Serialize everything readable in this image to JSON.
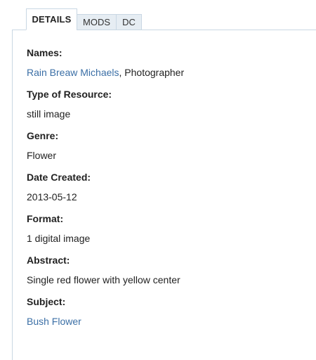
{
  "tabs": [
    {
      "label": "DETAILS",
      "active": true
    },
    {
      "label": "MODS",
      "active": false
    },
    {
      "label": "DC",
      "active": false
    }
  ],
  "fields": {
    "names": {
      "label": "Names:",
      "value_link": "Rain Breaw Michaels",
      "value_suffix": ", Photographer"
    },
    "type_of_resource": {
      "label": "Type of Resource:",
      "value": "still image"
    },
    "genre": {
      "label": "Genre:",
      "value": "Flower"
    },
    "date_created": {
      "label": "Date Created:",
      "value": "2013-05-12"
    },
    "format": {
      "label": "Format:",
      "value": "1 digital image"
    },
    "abstract": {
      "label": "Abstract:",
      "value": "Single red flower with yellow center"
    },
    "subject": {
      "label": "Subject:",
      "value_link": "Bush Flower"
    }
  },
  "colors": {
    "link": "#3b6fa6",
    "tab_border": "#c9d7e3",
    "tab_inactive_bg": "#e6edf3"
  }
}
